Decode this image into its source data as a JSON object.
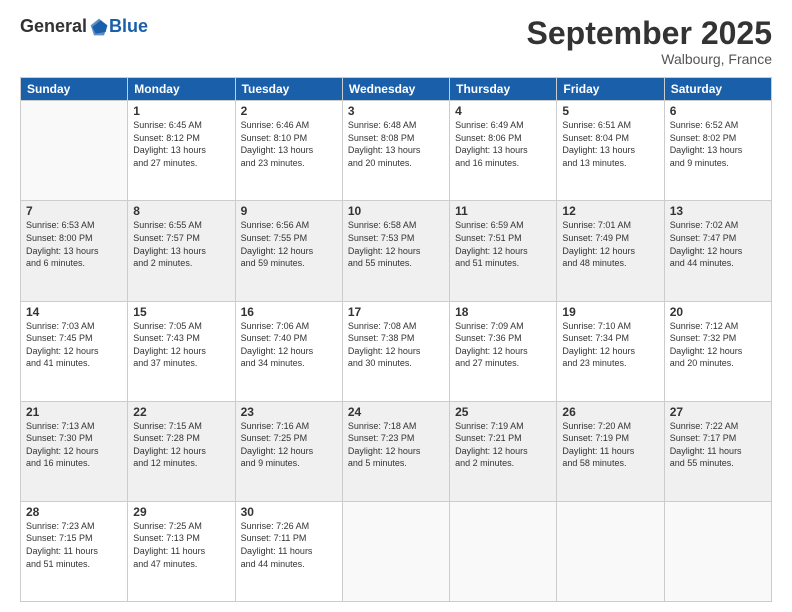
{
  "header": {
    "logo_general": "General",
    "logo_blue": "Blue",
    "month_title": "September 2025",
    "location": "Walbourg, France"
  },
  "days_of_week": [
    "Sunday",
    "Monday",
    "Tuesday",
    "Wednesday",
    "Thursday",
    "Friday",
    "Saturday"
  ],
  "weeks": [
    [
      {
        "day": "",
        "info": ""
      },
      {
        "day": "1",
        "info": "Sunrise: 6:45 AM\nSunset: 8:12 PM\nDaylight: 13 hours\nand 27 minutes."
      },
      {
        "day": "2",
        "info": "Sunrise: 6:46 AM\nSunset: 8:10 PM\nDaylight: 13 hours\nand 23 minutes."
      },
      {
        "day": "3",
        "info": "Sunrise: 6:48 AM\nSunset: 8:08 PM\nDaylight: 13 hours\nand 20 minutes."
      },
      {
        "day": "4",
        "info": "Sunrise: 6:49 AM\nSunset: 8:06 PM\nDaylight: 13 hours\nand 16 minutes."
      },
      {
        "day": "5",
        "info": "Sunrise: 6:51 AM\nSunset: 8:04 PM\nDaylight: 13 hours\nand 13 minutes."
      },
      {
        "day": "6",
        "info": "Sunrise: 6:52 AM\nSunset: 8:02 PM\nDaylight: 13 hours\nand 9 minutes."
      }
    ],
    [
      {
        "day": "7",
        "info": "Sunrise: 6:53 AM\nSunset: 8:00 PM\nDaylight: 13 hours\nand 6 minutes."
      },
      {
        "day": "8",
        "info": "Sunrise: 6:55 AM\nSunset: 7:57 PM\nDaylight: 13 hours\nand 2 minutes."
      },
      {
        "day": "9",
        "info": "Sunrise: 6:56 AM\nSunset: 7:55 PM\nDaylight: 12 hours\nand 59 minutes."
      },
      {
        "day": "10",
        "info": "Sunrise: 6:58 AM\nSunset: 7:53 PM\nDaylight: 12 hours\nand 55 minutes."
      },
      {
        "day": "11",
        "info": "Sunrise: 6:59 AM\nSunset: 7:51 PM\nDaylight: 12 hours\nand 51 minutes."
      },
      {
        "day": "12",
        "info": "Sunrise: 7:01 AM\nSunset: 7:49 PM\nDaylight: 12 hours\nand 48 minutes."
      },
      {
        "day": "13",
        "info": "Sunrise: 7:02 AM\nSunset: 7:47 PM\nDaylight: 12 hours\nand 44 minutes."
      }
    ],
    [
      {
        "day": "14",
        "info": "Sunrise: 7:03 AM\nSunset: 7:45 PM\nDaylight: 12 hours\nand 41 minutes."
      },
      {
        "day": "15",
        "info": "Sunrise: 7:05 AM\nSunset: 7:43 PM\nDaylight: 12 hours\nand 37 minutes."
      },
      {
        "day": "16",
        "info": "Sunrise: 7:06 AM\nSunset: 7:40 PM\nDaylight: 12 hours\nand 34 minutes."
      },
      {
        "day": "17",
        "info": "Sunrise: 7:08 AM\nSunset: 7:38 PM\nDaylight: 12 hours\nand 30 minutes."
      },
      {
        "day": "18",
        "info": "Sunrise: 7:09 AM\nSunset: 7:36 PM\nDaylight: 12 hours\nand 27 minutes."
      },
      {
        "day": "19",
        "info": "Sunrise: 7:10 AM\nSunset: 7:34 PM\nDaylight: 12 hours\nand 23 minutes."
      },
      {
        "day": "20",
        "info": "Sunrise: 7:12 AM\nSunset: 7:32 PM\nDaylight: 12 hours\nand 20 minutes."
      }
    ],
    [
      {
        "day": "21",
        "info": "Sunrise: 7:13 AM\nSunset: 7:30 PM\nDaylight: 12 hours\nand 16 minutes."
      },
      {
        "day": "22",
        "info": "Sunrise: 7:15 AM\nSunset: 7:28 PM\nDaylight: 12 hours\nand 12 minutes."
      },
      {
        "day": "23",
        "info": "Sunrise: 7:16 AM\nSunset: 7:25 PM\nDaylight: 12 hours\nand 9 minutes."
      },
      {
        "day": "24",
        "info": "Sunrise: 7:18 AM\nSunset: 7:23 PM\nDaylight: 12 hours\nand 5 minutes."
      },
      {
        "day": "25",
        "info": "Sunrise: 7:19 AM\nSunset: 7:21 PM\nDaylight: 12 hours\nand 2 minutes."
      },
      {
        "day": "26",
        "info": "Sunrise: 7:20 AM\nSunset: 7:19 PM\nDaylight: 11 hours\nand 58 minutes."
      },
      {
        "day": "27",
        "info": "Sunrise: 7:22 AM\nSunset: 7:17 PM\nDaylight: 11 hours\nand 55 minutes."
      }
    ],
    [
      {
        "day": "28",
        "info": "Sunrise: 7:23 AM\nSunset: 7:15 PM\nDaylight: 11 hours\nand 51 minutes."
      },
      {
        "day": "29",
        "info": "Sunrise: 7:25 AM\nSunset: 7:13 PM\nDaylight: 11 hours\nand 47 minutes."
      },
      {
        "day": "30",
        "info": "Sunrise: 7:26 AM\nSunset: 7:11 PM\nDaylight: 11 hours\nand 44 minutes."
      },
      {
        "day": "",
        "info": ""
      },
      {
        "day": "",
        "info": ""
      },
      {
        "day": "",
        "info": ""
      },
      {
        "day": "",
        "info": ""
      }
    ]
  ]
}
